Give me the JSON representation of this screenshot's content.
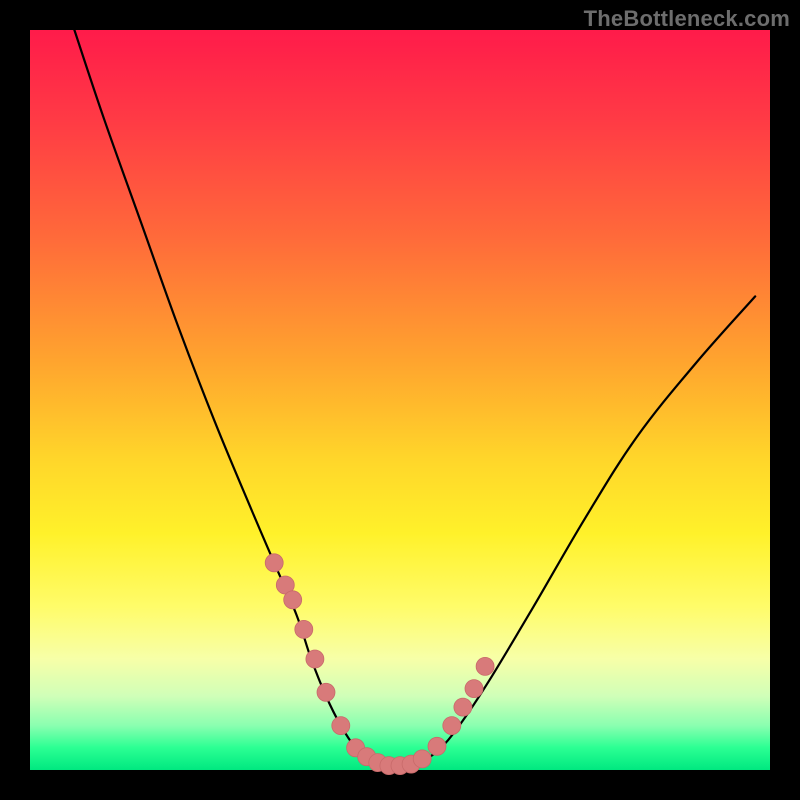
{
  "watermark": {
    "text": "TheBottleneck.com"
  },
  "chart_data": {
    "type": "line",
    "title": "",
    "xlabel": "",
    "ylabel": "",
    "xlim": [
      0,
      100
    ],
    "ylim": [
      0,
      100
    ],
    "background_gradient": {
      "top": "#ff1b4a",
      "mid": "#ffd62a",
      "bottom": "#00e880"
    },
    "series": [
      {
        "name": "bottleneck-curve",
        "x": [
          6,
          10,
          15,
          20,
          25,
          30,
          33,
          36,
          38,
          40,
          42,
          44,
          46,
          48,
          50,
          52,
          55,
          58,
          62,
          68,
          75,
          82,
          90,
          98
        ],
        "y": [
          100,
          88,
          74,
          60,
          47,
          35,
          28,
          21,
          15,
          10,
          6,
          3,
          1.2,
          0.5,
          0.5,
          0.8,
          2.5,
          6,
          12,
          22,
          34,
          45,
          55,
          64
        ]
      }
    ],
    "markers": {
      "name": "scatter-points",
      "x": [
        33,
        34.5,
        35.5,
        37,
        38.5,
        40,
        42,
        44,
        45.5,
        47,
        48.5,
        50,
        51.5,
        53,
        55,
        57,
        58.5,
        60,
        61.5
      ],
      "y": [
        28,
        25,
        23,
        19,
        15,
        10.5,
        6,
        3,
        1.8,
        1,
        0.6,
        0.6,
        0.8,
        1.5,
        3.2,
        6,
        8.5,
        11,
        14
      ]
    }
  }
}
